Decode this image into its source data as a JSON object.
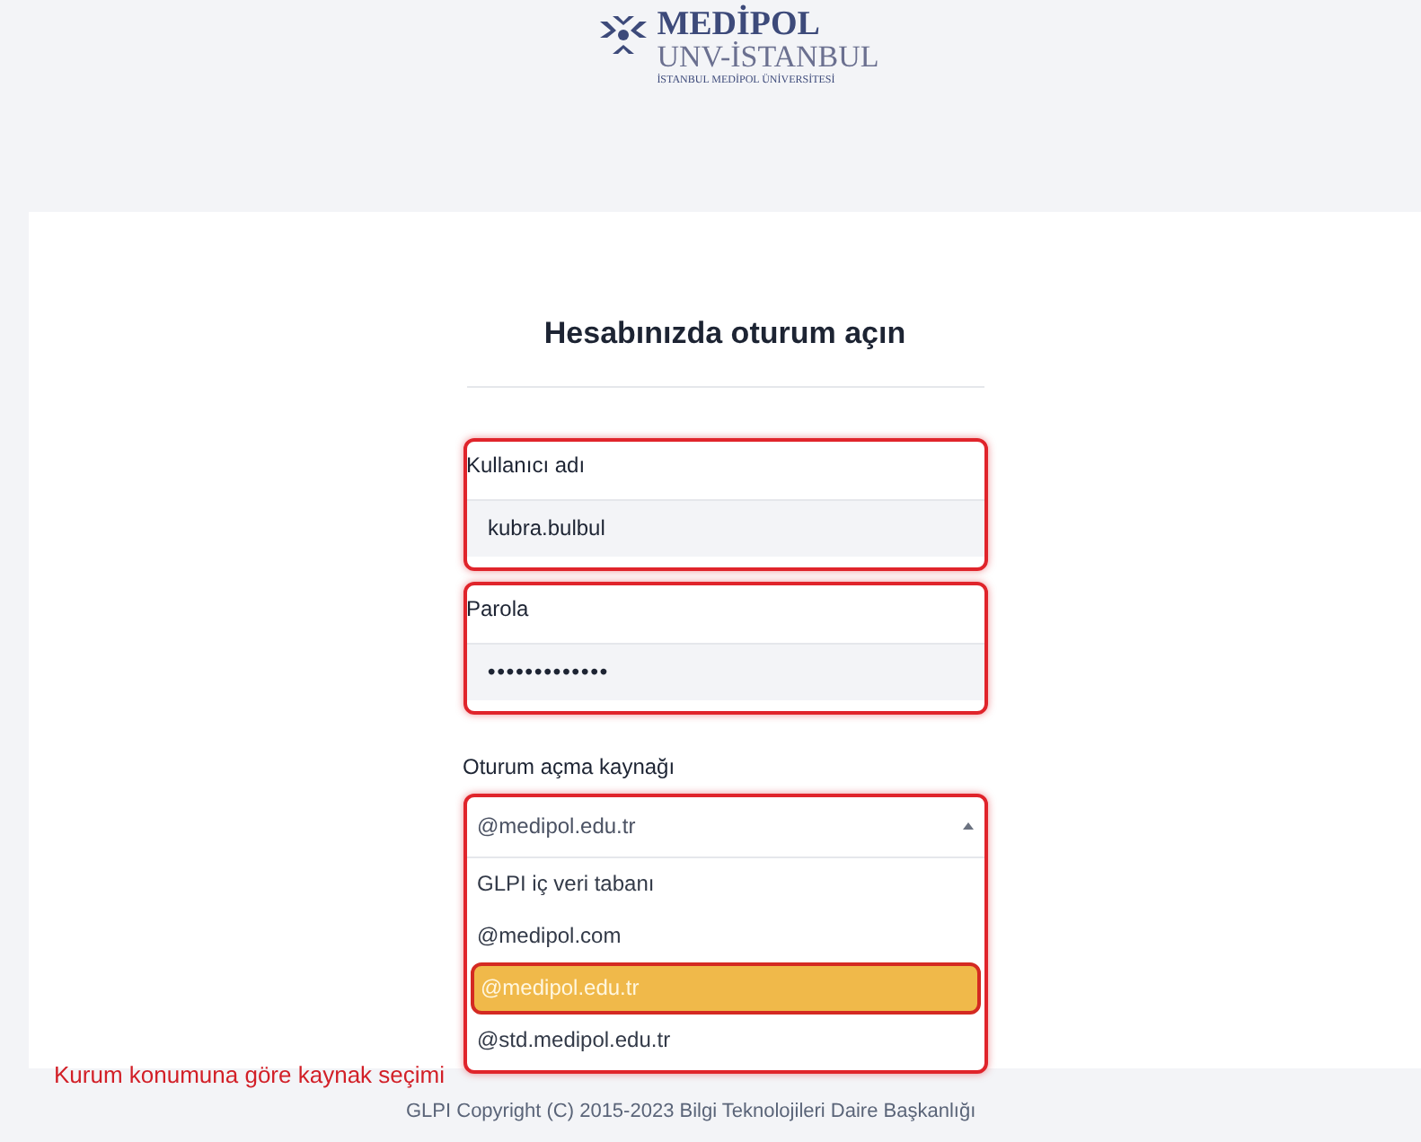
{
  "logo": {
    "name": "MEDİPOL",
    "subtitle": "UNV-İSTANBUL",
    "tagline": "İSTANBUL MEDİPOL ÜNİVERSİTESİ"
  },
  "title": "Hesabınızda oturum açın",
  "fields": [
    {
      "kind": "text",
      "label": "Kullanıcı adı",
      "value": "kubra.bulbul",
      "highlighted": true
    },
    {
      "kind": "password",
      "label": "Parola",
      "value": "•••••••••••••",
      "highlighted": true
    }
  ],
  "source": {
    "label": "Oturum açma kaynağı",
    "value": "@medipol.edu.tr",
    "expanded": true,
    "highlighted": true,
    "options": [
      {
        "label": "GLPI iç veri tabanı",
        "selected": false
      },
      {
        "label": "@medipol.com",
        "selected": false
      },
      {
        "label": "@medipol.edu.tr",
        "selected": true
      },
      {
        "label": "@std.medipol.edu.tr",
        "selected": false
      }
    ]
  },
  "annotation": "Kurum konumuna göre kaynak seçimi",
  "footer": "GLPI Copyright (C) 2015-2023 Bilgi Teknolojileri Daire Başkanlığı"
}
